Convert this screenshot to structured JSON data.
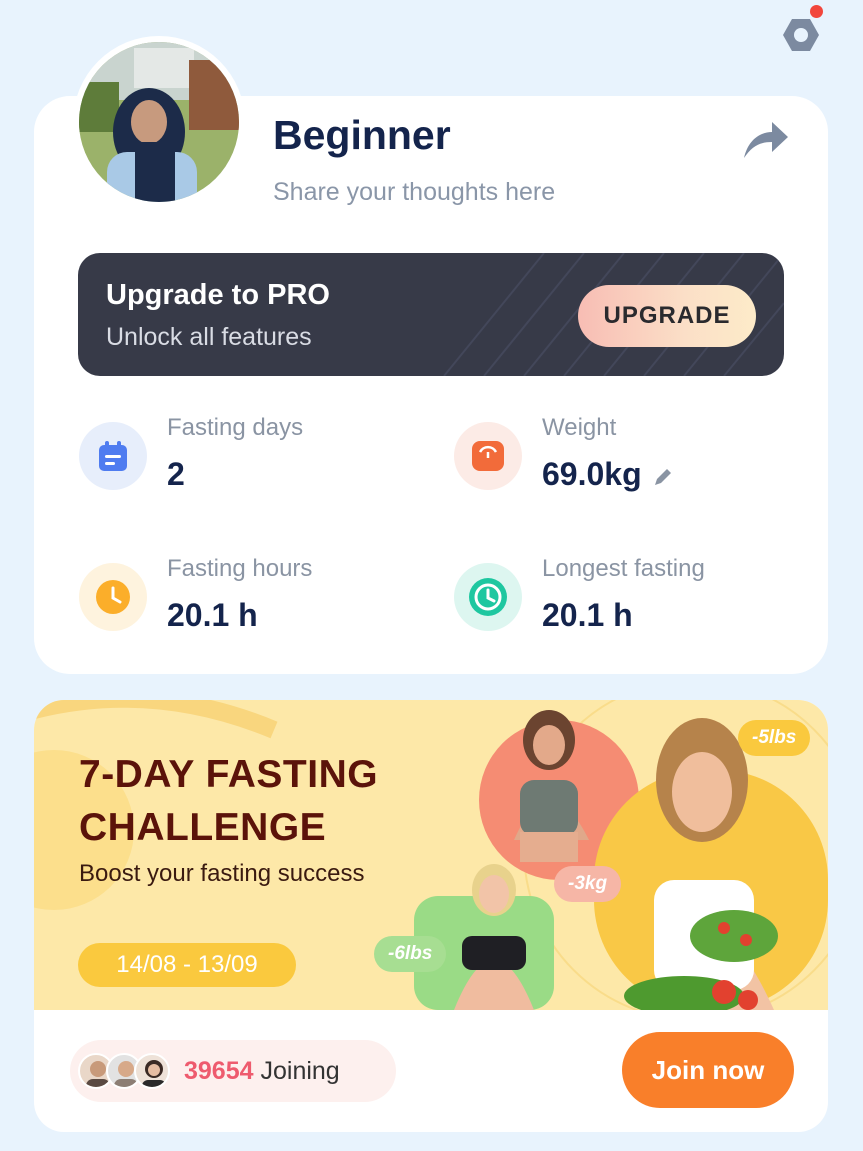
{
  "profile": {
    "level": "Beginner",
    "bio_placeholder": "Share your thoughts here"
  },
  "pro_banner": {
    "title": "Upgrade to PRO",
    "subtitle": "Unlock all features",
    "button_label": "UPGRADE"
  },
  "stats": {
    "fasting_days": {
      "label": "Fasting days",
      "value": "2",
      "icon": "calendar-icon"
    },
    "weight": {
      "label": "Weight",
      "value": "69.0kg",
      "icon": "scale-icon"
    },
    "fasting_hours": {
      "label": "Fasting hours",
      "value": "20.1 h",
      "icon": "clock-icon"
    },
    "longest_fasting": {
      "label": "Longest fasting",
      "value": "20.1 h",
      "icon": "timer-icon"
    }
  },
  "challenge": {
    "title_line1": "7-DAY FASTING",
    "title_line2": "CHALLENGE",
    "subtitle": "Boost your fasting success",
    "date_range": "14/08 - 13/09",
    "tags": [
      "-5lbs",
      "-3kg",
      "-6lbs"
    ],
    "joining_count": "39654",
    "joining_label": "Joining",
    "join_button": "Join now"
  },
  "colors": {
    "background": "#E8F3FD",
    "navy_text": "#14244C",
    "pro_banner": "#373A48",
    "challenge_banner": "#FDE8A8",
    "challenge_title": "#5B130A",
    "join_button": "#F97F2A",
    "joining_count": "#EE5B6E"
  }
}
